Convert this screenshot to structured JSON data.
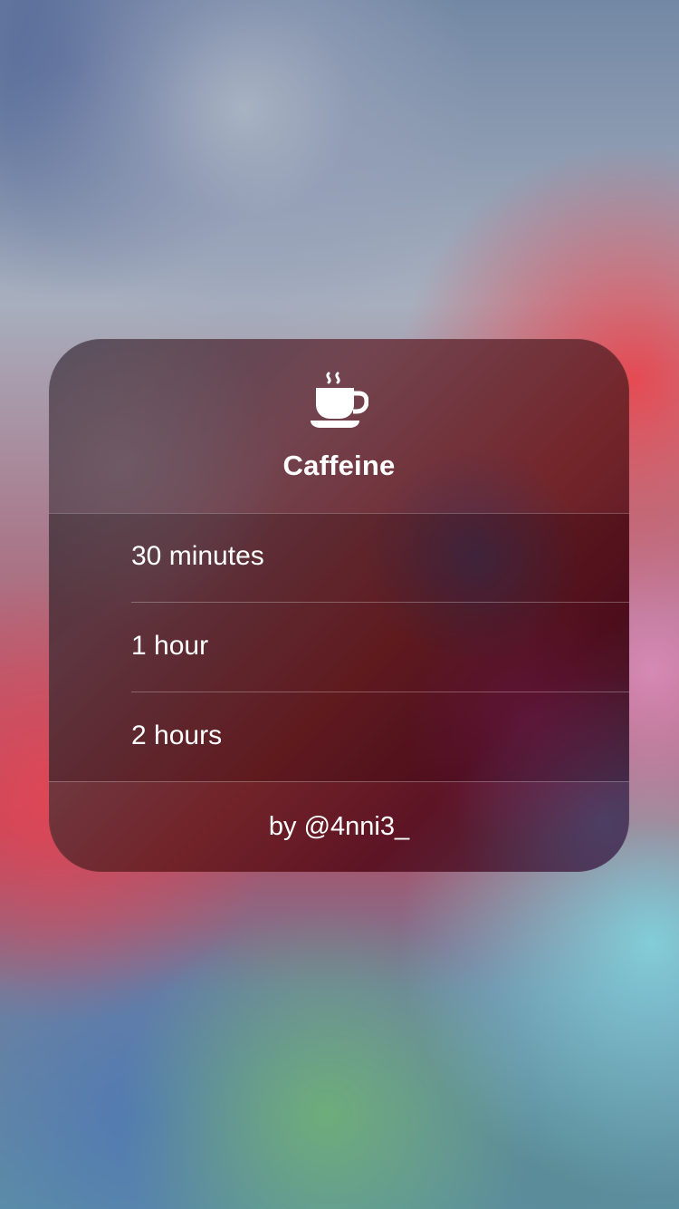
{
  "menu": {
    "icon": "coffee-cup-icon",
    "title": "Caffeine",
    "options": [
      {
        "label": "30 minutes"
      },
      {
        "label": "1 hour"
      },
      {
        "label": "2 hours"
      }
    ],
    "footer": "by @4nni3_"
  },
  "colors": {
    "text": "#FFFFFF",
    "card_dark": "#5A1020",
    "card_mid": "#6F1F24",
    "card_light": "#4E4A58"
  }
}
